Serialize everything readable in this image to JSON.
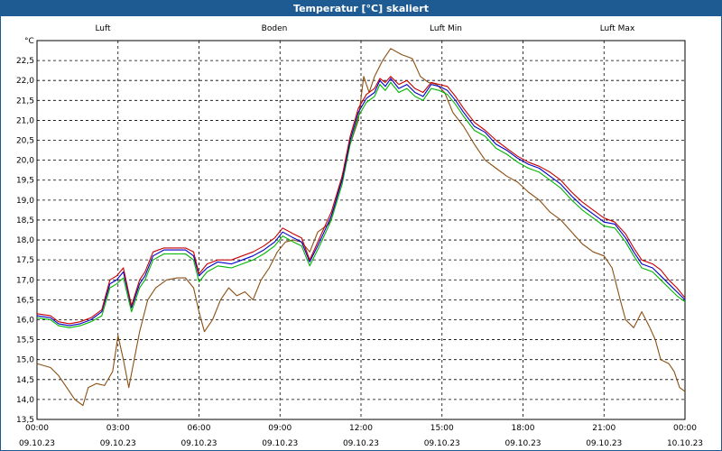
{
  "window": {
    "title": "Temperatur [°C] skaliert"
  },
  "colors": {
    "titlebar": "#1e5b93",
    "grid": "#000000",
    "plot_bg": "#ffffff"
  },
  "chart_data": {
    "type": "line",
    "title": "Temperatur [°C] skaliert",
    "ylabel": "°C",
    "xlabel": "",
    "ylim": [
      13.5,
      23.0
    ],
    "xlim": [
      0,
      24
    ],
    "grid": true,
    "legend_position": "top",
    "y_ticks": [
      "13,5",
      "14,0",
      "14,5",
      "15,0",
      "15,5",
      "16,0",
      "16,5",
      "17,0",
      "17,5",
      "18,0",
      "18,5",
      "19,0",
      "19,5",
      "20,0",
      "20,5",
      "21,0",
      "21,5",
      "22,0",
      "22,5"
    ],
    "x_ticks": [
      {
        "time": "00:00",
        "date": "09.10.23"
      },
      {
        "time": "03:00",
        "date": "09.10.23"
      },
      {
        "time": "06:00",
        "date": "09.10.23"
      },
      {
        "time": "09:00",
        "date": "09.10.23"
      },
      {
        "time": "12:00",
        "date": "09.10.23"
      },
      {
        "time": "15:00",
        "date": "09.10.23"
      },
      {
        "time": "18:00",
        "date": "09.10.23"
      },
      {
        "time": "21:00",
        "date": "09.10.23"
      },
      {
        "time": "00:00",
        "date": "10.10.23"
      }
    ],
    "series": [
      {
        "name": "Luft",
        "color": "#0000c8",
        "points": [
          [
            0,
            16.1
          ],
          [
            0.5,
            16.05
          ],
          [
            0.8,
            15.9
          ],
          [
            1.2,
            15.85
          ],
          [
            1.6,
            15.9
          ],
          [
            2.0,
            16.0
          ],
          [
            2.4,
            16.2
          ],
          [
            2.7,
            16.9
          ],
          [
            2.95,
            17.0
          ],
          [
            3.2,
            17.2
          ],
          [
            3.5,
            16.3
          ],
          [
            3.8,
            16.9
          ],
          [
            4.0,
            17.1
          ],
          [
            4.3,
            17.6
          ],
          [
            4.7,
            17.75
          ],
          [
            5.2,
            17.75
          ],
          [
            5.5,
            17.75
          ],
          [
            5.8,
            17.6
          ],
          [
            6.0,
            17.1
          ],
          [
            6.3,
            17.3
          ],
          [
            6.7,
            17.45
          ],
          [
            7.2,
            17.4
          ],
          [
            7.6,
            17.5
          ],
          [
            8.0,
            17.6
          ],
          [
            8.4,
            17.75
          ],
          [
            8.8,
            17.95
          ],
          [
            9.1,
            18.2
          ],
          [
            9.5,
            18.05
          ],
          [
            9.8,
            17.95
          ],
          [
            10.1,
            17.45
          ],
          [
            10.5,
            18.0
          ],
          [
            10.9,
            18.6
          ],
          [
            11.3,
            19.5
          ],
          [
            11.6,
            20.5
          ],
          [
            11.9,
            21.2
          ],
          [
            12.2,
            21.55
          ],
          [
            12.5,
            21.7
          ],
          [
            12.7,
            22.0
          ],
          [
            12.9,
            21.85
          ],
          [
            13.1,
            22.05
          ],
          [
            13.4,
            21.8
          ],
          [
            13.7,
            21.9
          ],
          [
            14.0,
            21.7
          ],
          [
            14.3,
            21.6
          ],
          [
            14.6,
            21.9
          ],
          [
            14.9,
            21.85
          ],
          [
            15.2,
            21.75
          ],
          [
            15.5,
            21.5
          ],
          [
            15.8,
            21.2
          ],
          [
            16.2,
            20.85
          ],
          [
            16.6,
            20.7
          ],
          [
            17.0,
            20.4
          ],
          [
            17.4,
            20.25
          ],
          [
            17.8,
            20.05
          ],
          [
            18.2,
            19.9
          ],
          [
            18.6,
            19.8
          ],
          [
            19.0,
            19.6
          ],
          [
            19.4,
            19.4
          ],
          [
            19.8,
            19.1
          ],
          [
            20.2,
            18.85
          ],
          [
            20.6,
            18.65
          ],
          [
            21.0,
            18.45
          ],
          [
            21.4,
            18.4
          ],
          [
            21.8,
            18.05
          ],
          [
            22.1,
            17.7
          ],
          [
            22.4,
            17.4
          ],
          [
            22.8,
            17.3
          ],
          [
            23.1,
            17.1
          ],
          [
            23.4,
            16.9
          ],
          [
            23.7,
            16.7
          ],
          [
            24.0,
            16.5
          ]
        ]
      },
      {
        "name": "Boden",
        "color": "#8b4f12",
        "points": [
          [
            0,
            14.9
          ],
          [
            0.5,
            14.8
          ],
          [
            0.8,
            14.6
          ],
          [
            1.1,
            14.3
          ],
          [
            1.4,
            14.0
          ],
          [
            1.7,
            13.85
          ],
          [
            1.9,
            14.3
          ],
          [
            2.2,
            14.4
          ],
          [
            2.5,
            14.35
          ],
          [
            2.8,
            14.7
          ],
          [
            3.0,
            15.6
          ],
          [
            3.2,
            15.0
          ],
          [
            3.4,
            14.3
          ],
          [
            3.6,
            15.0
          ],
          [
            3.8,
            15.7
          ],
          [
            4.1,
            16.5
          ],
          [
            4.4,
            16.8
          ],
          [
            4.8,
            17.0
          ],
          [
            5.2,
            17.05
          ],
          [
            5.5,
            17.05
          ],
          [
            5.8,
            16.8
          ],
          [
            6.0,
            16.2
          ],
          [
            6.2,
            15.7
          ],
          [
            6.5,
            16.0
          ],
          [
            6.8,
            16.5
          ],
          [
            7.1,
            16.8
          ],
          [
            7.4,
            16.6
          ],
          [
            7.7,
            16.7
          ],
          [
            8.0,
            16.5
          ],
          [
            8.3,
            17.0
          ],
          [
            8.6,
            17.3
          ],
          [
            8.9,
            17.7
          ],
          [
            9.2,
            17.95
          ],
          [
            9.5,
            18.0
          ],
          [
            9.8,
            17.95
          ],
          [
            10.1,
            17.7
          ],
          [
            10.4,
            18.2
          ],
          [
            10.8,
            18.4
          ],
          [
            11.0,
            18.8
          ],
          [
            11.3,
            19.6
          ],
          [
            11.6,
            20.4
          ],
          [
            11.9,
            21.0
          ],
          [
            12.1,
            22.1
          ],
          [
            12.3,
            21.7
          ],
          [
            12.5,
            22.1
          ],
          [
            12.8,
            22.5
          ],
          [
            13.1,
            22.8
          ],
          [
            13.5,
            22.65
          ],
          [
            13.9,
            22.55
          ],
          [
            14.2,
            22.1
          ],
          [
            14.5,
            21.95
          ],
          [
            14.8,
            21.9
          ],
          [
            15.1,
            21.7
          ],
          [
            15.4,
            21.2
          ],
          [
            15.8,
            20.85
          ],
          [
            16.2,
            20.4
          ],
          [
            16.6,
            20.0
          ],
          [
            17.0,
            19.8
          ],
          [
            17.4,
            19.6
          ],
          [
            17.8,
            19.45
          ],
          [
            18.2,
            19.2
          ],
          [
            18.6,
            19.0
          ],
          [
            19.0,
            18.7
          ],
          [
            19.4,
            18.5
          ],
          [
            19.8,
            18.2
          ],
          [
            20.2,
            17.9
          ],
          [
            20.6,
            17.7
          ],
          [
            21.0,
            17.6
          ],
          [
            21.3,
            17.3
          ],
          [
            21.6,
            16.5
          ],
          [
            21.8,
            16.0
          ],
          [
            22.1,
            15.8
          ],
          [
            22.4,
            16.2
          ],
          [
            22.7,
            15.8
          ],
          [
            22.9,
            15.5
          ],
          [
            23.1,
            15.0
          ],
          [
            23.4,
            14.9
          ],
          [
            23.6,
            14.7
          ],
          [
            23.8,
            14.3
          ],
          [
            24.0,
            14.2
          ]
        ]
      },
      {
        "name": "Luft Min",
        "color": "#00b400",
        "points": [
          [
            0,
            16.05
          ],
          [
            0.5,
            16.0
          ],
          [
            0.8,
            15.85
          ],
          [
            1.2,
            15.8
          ],
          [
            1.6,
            15.85
          ],
          [
            2.0,
            15.95
          ],
          [
            2.4,
            16.1
          ],
          [
            2.7,
            16.8
          ],
          [
            2.95,
            16.9
          ],
          [
            3.2,
            17.05
          ],
          [
            3.5,
            16.2
          ],
          [
            3.8,
            16.8
          ],
          [
            4.0,
            17.0
          ],
          [
            4.3,
            17.5
          ],
          [
            4.7,
            17.65
          ],
          [
            5.2,
            17.65
          ],
          [
            5.5,
            17.65
          ],
          [
            5.8,
            17.5
          ],
          [
            6.0,
            16.95
          ],
          [
            6.3,
            17.2
          ],
          [
            6.7,
            17.35
          ],
          [
            7.2,
            17.3
          ],
          [
            7.6,
            17.4
          ],
          [
            8.0,
            17.5
          ],
          [
            8.4,
            17.65
          ],
          [
            8.8,
            17.85
          ],
          [
            9.1,
            18.1
          ],
          [
            9.5,
            17.95
          ],
          [
            9.8,
            17.85
          ],
          [
            10.1,
            17.35
          ],
          [
            10.5,
            17.9
          ],
          [
            10.9,
            18.5
          ],
          [
            11.3,
            19.4
          ],
          [
            11.6,
            20.4
          ],
          [
            11.9,
            21.1
          ],
          [
            12.2,
            21.45
          ],
          [
            12.5,
            21.6
          ],
          [
            12.7,
            21.9
          ],
          [
            12.9,
            21.75
          ],
          [
            13.1,
            21.95
          ],
          [
            13.4,
            21.7
          ],
          [
            13.7,
            21.8
          ],
          [
            14.0,
            21.6
          ],
          [
            14.3,
            21.5
          ],
          [
            14.6,
            21.8
          ],
          [
            14.9,
            21.75
          ],
          [
            15.2,
            21.65
          ],
          [
            15.5,
            21.4
          ],
          [
            15.8,
            21.1
          ],
          [
            16.2,
            20.75
          ],
          [
            16.6,
            20.6
          ],
          [
            17.0,
            20.3
          ],
          [
            17.4,
            20.15
          ],
          [
            17.8,
            19.95
          ],
          [
            18.2,
            19.8
          ],
          [
            18.6,
            19.7
          ],
          [
            19.0,
            19.5
          ],
          [
            19.4,
            19.3
          ],
          [
            19.8,
            19.0
          ],
          [
            20.2,
            18.75
          ],
          [
            20.6,
            18.55
          ],
          [
            21.0,
            18.35
          ],
          [
            21.4,
            18.3
          ],
          [
            21.8,
            17.95
          ],
          [
            22.1,
            17.6
          ],
          [
            22.4,
            17.3
          ],
          [
            22.8,
            17.2
          ],
          [
            23.1,
            17.0
          ],
          [
            23.4,
            16.8
          ],
          [
            23.7,
            16.6
          ],
          [
            24.0,
            16.45
          ]
        ]
      },
      {
        "name": "Luft Max",
        "color": "#c80000",
        "points": [
          [
            0,
            16.15
          ],
          [
            0.5,
            16.1
          ],
          [
            0.8,
            15.95
          ],
          [
            1.2,
            15.9
          ],
          [
            1.6,
            15.95
          ],
          [
            2.0,
            16.05
          ],
          [
            2.4,
            16.25
          ],
          [
            2.7,
            17.0
          ],
          [
            2.95,
            17.1
          ],
          [
            3.2,
            17.3
          ],
          [
            3.5,
            16.35
          ],
          [
            3.8,
            17.0
          ],
          [
            4.0,
            17.2
          ],
          [
            4.3,
            17.7
          ],
          [
            4.7,
            17.8
          ],
          [
            5.2,
            17.8
          ],
          [
            5.5,
            17.8
          ],
          [
            5.8,
            17.7
          ],
          [
            6.0,
            17.15
          ],
          [
            6.3,
            17.4
          ],
          [
            6.7,
            17.5
          ],
          [
            7.2,
            17.5
          ],
          [
            7.6,
            17.6
          ],
          [
            8.0,
            17.7
          ],
          [
            8.4,
            17.85
          ],
          [
            8.8,
            18.05
          ],
          [
            9.1,
            18.3
          ],
          [
            9.5,
            18.15
          ],
          [
            9.8,
            18.05
          ],
          [
            10.1,
            17.5
          ],
          [
            10.5,
            18.1
          ],
          [
            10.9,
            18.7
          ],
          [
            11.3,
            19.6
          ],
          [
            11.6,
            20.6
          ],
          [
            11.9,
            21.3
          ],
          [
            12.2,
            21.65
          ],
          [
            12.5,
            21.8
          ],
          [
            12.7,
            22.05
          ],
          [
            12.9,
            21.95
          ],
          [
            13.1,
            22.1
          ],
          [
            13.4,
            21.9
          ],
          [
            13.7,
            22.0
          ],
          [
            14.0,
            21.8
          ],
          [
            14.3,
            21.7
          ],
          [
            14.6,
            21.95
          ],
          [
            14.9,
            21.9
          ],
          [
            15.2,
            21.85
          ],
          [
            15.5,
            21.6
          ],
          [
            15.8,
            21.3
          ],
          [
            16.2,
            20.95
          ],
          [
            16.6,
            20.75
          ],
          [
            17.0,
            20.5
          ],
          [
            17.4,
            20.3
          ],
          [
            17.8,
            20.1
          ],
          [
            18.2,
            19.95
          ],
          [
            18.6,
            19.85
          ],
          [
            19.0,
            19.7
          ],
          [
            19.4,
            19.5
          ],
          [
            19.8,
            19.2
          ],
          [
            20.2,
            18.95
          ],
          [
            20.6,
            18.75
          ],
          [
            21.0,
            18.55
          ],
          [
            21.4,
            18.45
          ],
          [
            21.8,
            18.15
          ],
          [
            22.1,
            17.8
          ],
          [
            22.4,
            17.5
          ],
          [
            22.8,
            17.4
          ],
          [
            23.1,
            17.25
          ],
          [
            23.4,
            17.0
          ],
          [
            23.7,
            16.8
          ],
          [
            24.0,
            16.55
          ]
        ]
      }
    ]
  }
}
